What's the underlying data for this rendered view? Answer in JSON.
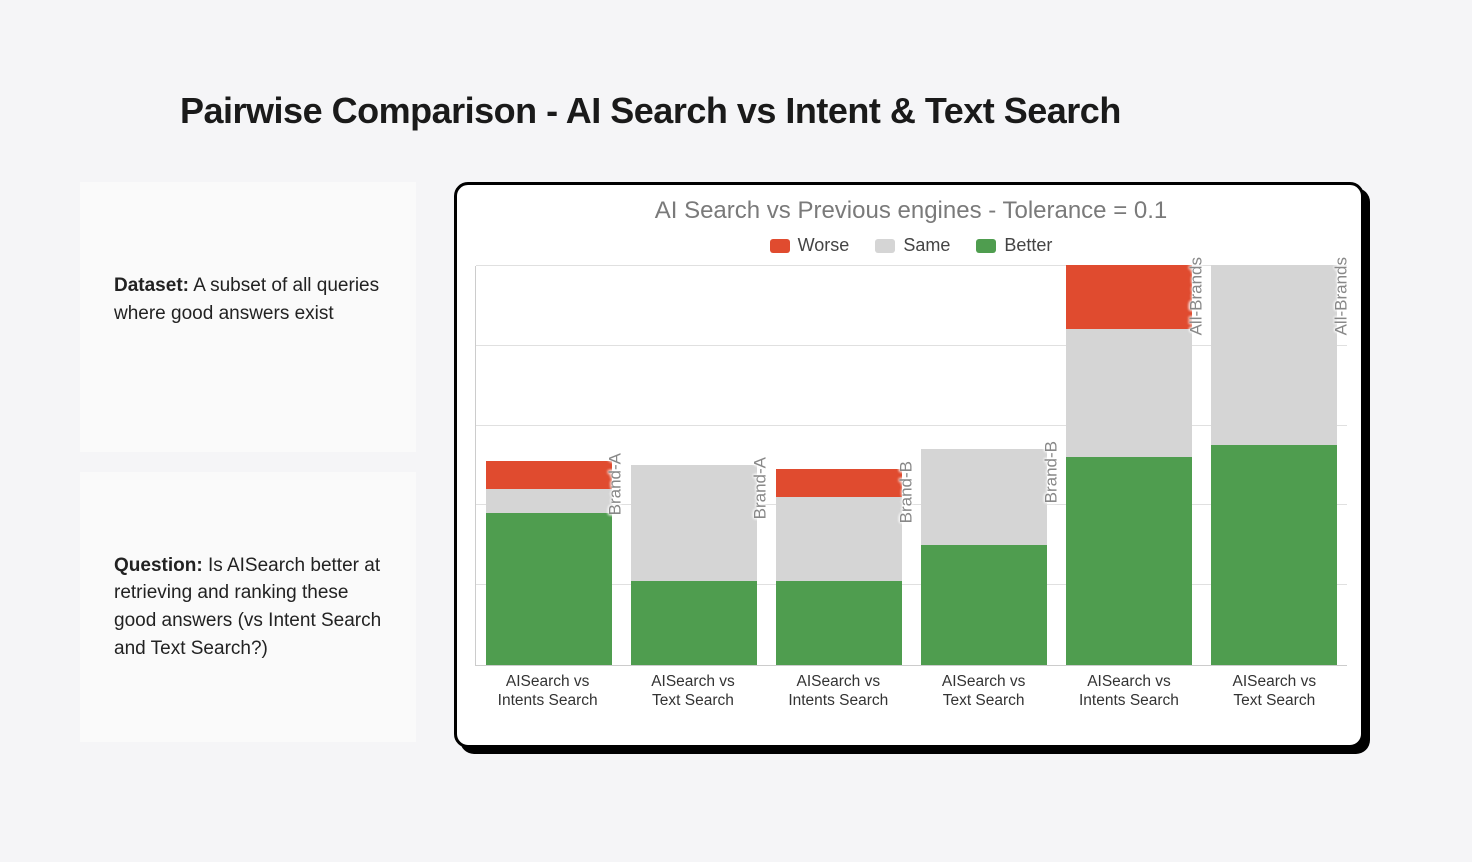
{
  "title": "Pairwise Comparison - AI Search vs Intent & Text Search",
  "left": {
    "dataset_label": "Dataset:",
    "dataset_text": " A subset of all queries where good answers exist",
    "question_label": "Question:",
    "question_text": " Is AISearch better at retrieving and ranking these good answers (vs Intent Search and Text Search?)"
  },
  "legend": {
    "worse": "Worse",
    "same": "Same",
    "better": "Better"
  },
  "colors": {
    "worse": "#e04b2f",
    "same": "#d5d5d5",
    "better": "#4f9d4f"
  },
  "chart_data": {
    "type": "bar",
    "title": "AI Search vs Previous engines - Tolerance = 0.1",
    "stacked": true,
    "categories": [
      "AISearch vs Intents Search",
      "AISearch vs Text Search",
      "AISearch vs Intents Search",
      "AISearch vs Text Search",
      "AISearch vs Intents Search",
      "AISearch vs Text Search"
    ],
    "group_labels": [
      "Brand-A",
      "Brand-A",
      "Brand-B",
      "Brand-B",
      "All-Brands",
      "All-Brands"
    ],
    "series": [
      {
        "name": "Better",
        "values": [
          38,
          21,
          21,
          30,
          52,
          55
        ]
      },
      {
        "name": "Same",
        "values": [
          6,
          29,
          21,
          24,
          32,
          45
        ]
      },
      {
        "name": "Worse",
        "values": [
          7,
          0,
          7,
          0,
          16,
          0
        ]
      }
    ],
    "ylim": [
      0,
      100
    ],
    "gridlines": [
      20,
      40,
      60,
      80,
      100
    ],
    "xlabel": "",
    "ylabel": ""
  }
}
